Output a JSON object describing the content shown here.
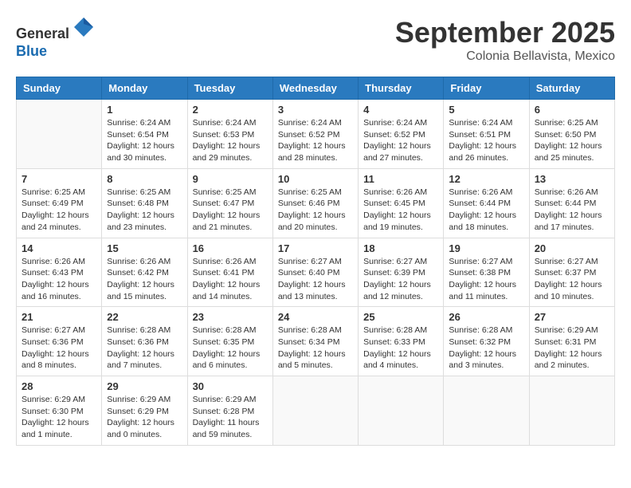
{
  "header": {
    "logo_line1": "General",
    "logo_line2": "Blue",
    "month": "September 2025",
    "location": "Colonia Bellavista, Mexico"
  },
  "days_of_week": [
    "Sunday",
    "Monday",
    "Tuesday",
    "Wednesday",
    "Thursday",
    "Friday",
    "Saturday"
  ],
  "weeks": [
    [
      {
        "day": "",
        "info": ""
      },
      {
        "day": "1",
        "info": "Sunrise: 6:24 AM\nSunset: 6:54 PM\nDaylight: 12 hours\nand 30 minutes."
      },
      {
        "day": "2",
        "info": "Sunrise: 6:24 AM\nSunset: 6:53 PM\nDaylight: 12 hours\nand 29 minutes."
      },
      {
        "day": "3",
        "info": "Sunrise: 6:24 AM\nSunset: 6:52 PM\nDaylight: 12 hours\nand 28 minutes."
      },
      {
        "day": "4",
        "info": "Sunrise: 6:24 AM\nSunset: 6:52 PM\nDaylight: 12 hours\nand 27 minutes."
      },
      {
        "day": "5",
        "info": "Sunrise: 6:24 AM\nSunset: 6:51 PM\nDaylight: 12 hours\nand 26 minutes."
      },
      {
        "day": "6",
        "info": "Sunrise: 6:25 AM\nSunset: 6:50 PM\nDaylight: 12 hours\nand 25 minutes."
      }
    ],
    [
      {
        "day": "7",
        "info": "Sunrise: 6:25 AM\nSunset: 6:49 PM\nDaylight: 12 hours\nand 24 minutes."
      },
      {
        "day": "8",
        "info": "Sunrise: 6:25 AM\nSunset: 6:48 PM\nDaylight: 12 hours\nand 23 minutes."
      },
      {
        "day": "9",
        "info": "Sunrise: 6:25 AM\nSunset: 6:47 PM\nDaylight: 12 hours\nand 21 minutes."
      },
      {
        "day": "10",
        "info": "Sunrise: 6:25 AM\nSunset: 6:46 PM\nDaylight: 12 hours\nand 20 minutes."
      },
      {
        "day": "11",
        "info": "Sunrise: 6:26 AM\nSunset: 6:45 PM\nDaylight: 12 hours\nand 19 minutes."
      },
      {
        "day": "12",
        "info": "Sunrise: 6:26 AM\nSunset: 6:44 PM\nDaylight: 12 hours\nand 18 minutes."
      },
      {
        "day": "13",
        "info": "Sunrise: 6:26 AM\nSunset: 6:44 PM\nDaylight: 12 hours\nand 17 minutes."
      }
    ],
    [
      {
        "day": "14",
        "info": "Sunrise: 6:26 AM\nSunset: 6:43 PM\nDaylight: 12 hours\nand 16 minutes."
      },
      {
        "day": "15",
        "info": "Sunrise: 6:26 AM\nSunset: 6:42 PM\nDaylight: 12 hours\nand 15 minutes."
      },
      {
        "day": "16",
        "info": "Sunrise: 6:26 AM\nSunset: 6:41 PM\nDaylight: 12 hours\nand 14 minutes."
      },
      {
        "day": "17",
        "info": "Sunrise: 6:27 AM\nSunset: 6:40 PM\nDaylight: 12 hours\nand 13 minutes."
      },
      {
        "day": "18",
        "info": "Sunrise: 6:27 AM\nSunset: 6:39 PM\nDaylight: 12 hours\nand 12 minutes."
      },
      {
        "day": "19",
        "info": "Sunrise: 6:27 AM\nSunset: 6:38 PM\nDaylight: 12 hours\nand 11 minutes."
      },
      {
        "day": "20",
        "info": "Sunrise: 6:27 AM\nSunset: 6:37 PM\nDaylight: 12 hours\nand 10 minutes."
      }
    ],
    [
      {
        "day": "21",
        "info": "Sunrise: 6:27 AM\nSunset: 6:36 PM\nDaylight: 12 hours\nand 8 minutes."
      },
      {
        "day": "22",
        "info": "Sunrise: 6:28 AM\nSunset: 6:36 PM\nDaylight: 12 hours\nand 7 minutes."
      },
      {
        "day": "23",
        "info": "Sunrise: 6:28 AM\nSunset: 6:35 PM\nDaylight: 12 hours\nand 6 minutes."
      },
      {
        "day": "24",
        "info": "Sunrise: 6:28 AM\nSunset: 6:34 PM\nDaylight: 12 hours\nand 5 minutes."
      },
      {
        "day": "25",
        "info": "Sunrise: 6:28 AM\nSunset: 6:33 PM\nDaylight: 12 hours\nand 4 minutes."
      },
      {
        "day": "26",
        "info": "Sunrise: 6:28 AM\nSunset: 6:32 PM\nDaylight: 12 hours\nand 3 minutes."
      },
      {
        "day": "27",
        "info": "Sunrise: 6:29 AM\nSunset: 6:31 PM\nDaylight: 12 hours\nand 2 minutes."
      }
    ],
    [
      {
        "day": "28",
        "info": "Sunrise: 6:29 AM\nSunset: 6:30 PM\nDaylight: 12 hours\nand 1 minute."
      },
      {
        "day": "29",
        "info": "Sunrise: 6:29 AM\nSunset: 6:29 PM\nDaylight: 12 hours\nand 0 minutes."
      },
      {
        "day": "30",
        "info": "Sunrise: 6:29 AM\nSunset: 6:28 PM\nDaylight: 11 hours\nand 59 minutes."
      },
      {
        "day": "",
        "info": ""
      },
      {
        "day": "",
        "info": ""
      },
      {
        "day": "",
        "info": ""
      },
      {
        "day": "",
        "info": ""
      }
    ]
  ]
}
